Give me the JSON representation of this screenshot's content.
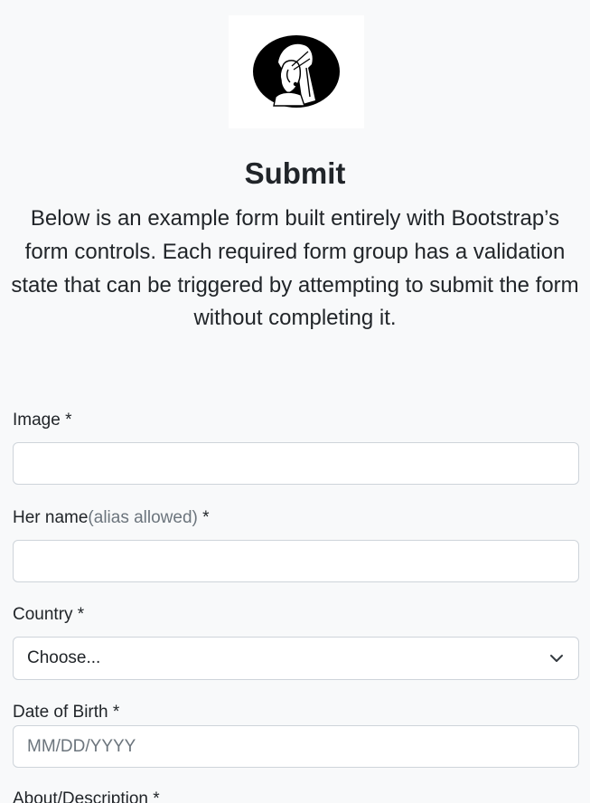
{
  "header": {
    "logo_icon": "girl-with-pearl-earring-logo-icon",
    "title": "Submit",
    "lead": "Below is an example form built entirely with Bootstrap’s form controls. Each required form group has a validation state that can be triggered by attempting to submit the form without completing it."
  },
  "form": {
    "image": {
      "label": "Image *",
      "value": ""
    },
    "her_name": {
      "label": "Her name",
      "hint": "(alias allowed)",
      "required_mark": " *",
      "value": ""
    },
    "country": {
      "label": "Country *",
      "selected": "Choose...",
      "icon": "chevron-down-icon"
    },
    "dob": {
      "label": "Date of Birth *",
      "placeholder": "MM/DD/YYYY",
      "value": ""
    },
    "about": {
      "label": "About/Description *"
    }
  },
  "colors": {
    "background": "#f8f9fa",
    "text": "#212529",
    "muted": "#6c757d",
    "border": "#ced4da"
  }
}
